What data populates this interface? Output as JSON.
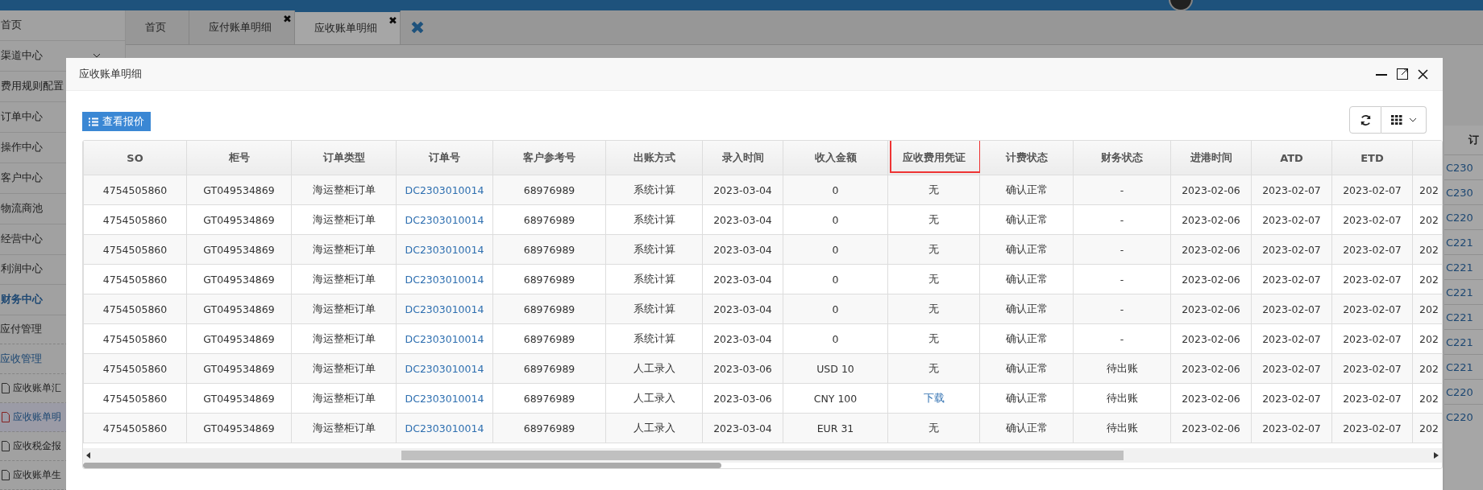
{
  "sidebar": {
    "items": [
      {
        "label": "首页",
        "active": false,
        "selected": false
      },
      {
        "label": "渠道中心",
        "expandable": true,
        "active": false,
        "selected": false
      },
      {
        "label": "费用规则配置",
        "active": false,
        "selected": false
      },
      {
        "label": "订单中心",
        "active": false,
        "selected": false
      },
      {
        "label": "操作中心",
        "active": false,
        "selected": false
      },
      {
        "label": "客户中心",
        "active": false,
        "selected": false
      },
      {
        "label": "物流商池",
        "active": false,
        "selected": false
      },
      {
        "label": "经营中心",
        "active": false,
        "selected": false
      },
      {
        "label": "利润中心",
        "active": false,
        "selected": false
      },
      {
        "label": "财务中心",
        "active": true,
        "selected": false,
        "children": [
          {
            "label": "应付管理",
            "active": false,
            "selected": false
          },
          {
            "label": "应收管理",
            "active": true,
            "selected": false,
            "children": [
              {
                "label": "应收账单汇",
                "selected": false
              },
              {
                "label": "应收账单明",
                "selected": true
              },
              {
                "label": "应收税金报",
                "selected": false
              },
              {
                "label": "应收账单生",
                "selected": false
              }
            ]
          }
        ]
      }
    ]
  },
  "tabs": [
    {
      "label": "首页",
      "selected": false
    },
    {
      "label": "应付账单明细",
      "close": "✖",
      "selected": false
    },
    {
      "label": "应收账单明细",
      "close": "✖",
      "selected": true
    }
  ],
  "close_all_tabs": "✖",
  "background_table": {
    "column_1": "订",
    "cells": [
      "C230",
      "C230",
      "C220",
      "C221",
      "C221",
      "C221",
      "C221",
      "C221",
      "C221",
      "C220",
      "C220"
    ]
  },
  "modal": {
    "title": "应收账单明细",
    "quote_button": "查看报价",
    "table": {
      "columns": [
        {
          "label": "SO",
          "highlighted": false
        },
        {
          "label": "柜号",
          "highlighted": false
        },
        {
          "label": "订单类型",
          "highlighted": false
        },
        {
          "label": "订单号",
          "highlighted": false
        },
        {
          "label": "客户参考号",
          "highlighted": false
        },
        {
          "label": "出账方式",
          "highlighted": false
        },
        {
          "label": "录入时间",
          "highlighted": false
        },
        {
          "label": "收入金额",
          "highlighted": false
        },
        {
          "label": "应收费用凭证",
          "highlighted": true
        },
        {
          "label": "计费状态",
          "highlighted": false
        },
        {
          "label": "财务状态",
          "highlighted": false
        },
        {
          "label": "进港时间",
          "highlighted": false
        },
        {
          "label": "ATD",
          "highlighted": false
        },
        {
          "label": "ETD",
          "highlighted": false
        },
        {
          "highlighted": false
        }
      ],
      "rows": [
        {
          "cells": [
            "4754505860",
            "GT049534869",
            "海运整柜订单",
            {
              "text": "DC2303010014",
              "link": true
            },
            "68976989",
            "系统计算",
            "2023-03-04",
            "0",
            "无",
            "确认正常",
            "-",
            "2023-02-06",
            "2023-02-07",
            "2023-02-07",
            "202"
          ]
        },
        {
          "cells": [
            "4754505860",
            "GT049534869",
            "海运整柜订单",
            {
              "text": "DC2303010014",
              "link": true
            },
            "68976989",
            "系统计算",
            "2023-03-04",
            "0",
            "无",
            "确认正常",
            "-",
            "2023-02-06",
            "2023-02-07",
            "2023-02-07",
            "202"
          ]
        },
        {
          "cells": [
            "4754505860",
            "GT049534869",
            "海运整柜订单",
            {
              "text": "DC2303010014",
              "link": true
            },
            "68976989",
            "系统计算",
            "2023-03-04",
            "0",
            "无",
            "确认正常",
            "-",
            "2023-02-06",
            "2023-02-07",
            "2023-02-07",
            "202"
          ]
        },
        {
          "cells": [
            "4754505860",
            "GT049534869",
            "海运整柜订单",
            {
              "text": "DC2303010014",
              "link": true
            },
            "68976989",
            "系统计算",
            "2023-03-04",
            "0",
            "无",
            "确认正常",
            "-",
            "2023-02-06",
            "2023-02-07",
            "2023-02-07",
            "202"
          ]
        },
        {
          "cells": [
            "4754505860",
            "GT049534869",
            "海运整柜订单",
            {
              "text": "DC2303010014",
              "link": true
            },
            "68976989",
            "系统计算",
            "2023-03-04",
            "0",
            "无",
            "确认正常",
            "-",
            "2023-02-06",
            "2023-02-07",
            "2023-02-07",
            "202"
          ]
        },
        {
          "cells": [
            "4754505860",
            "GT049534869",
            "海运整柜订单",
            {
              "text": "DC2303010014",
              "link": true
            },
            "68976989",
            "系统计算",
            "2023-03-04",
            "0",
            "无",
            "确认正常",
            "-",
            "2023-02-06",
            "2023-02-07",
            "2023-02-07",
            "202"
          ]
        },
        {
          "cells": [
            "4754505860",
            "GT049534869",
            "海运整柜订单",
            {
              "text": "DC2303010014",
              "link": true
            },
            "68976989",
            "人工录入",
            "2023-03-06",
            "USD 10",
            "无",
            "确认正常",
            "待出账",
            "2023-02-06",
            "2023-02-07",
            "2023-02-07",
            "202"
          ]
        },
        {
          "cells": [
            "4754505860",
            "GT049534869",
            "海运整柜订单",
            {
              "text": "DC2303010014",
              "link": true
            },
            "68976989",
            "人工录入",
            "2023-03-06",
            "CNY 100",
            {
              "text": "下载",
              "link": true
            },
            "确认正常",
            "待出账",
            "2023-02-06",
            "2023-02-07",
            "2023-02-07",
            "202"
          ]
        },
        {
          "cells": [
            "4754505860",
            "GT049534869",
            "海运整柜订单",
            {
              "text": "DC2303010014",
              "link": true
            },
            "68976989",
            "人工录入",
            "2023-03-04",
            "EUR 31",
            "无",
            "确认正常",
            "待出账",
            "2023-02-06",
            "2023-02-07",
            "2023-02-07",
            "202"
          ]
        }
      ]
    }
  }
}
